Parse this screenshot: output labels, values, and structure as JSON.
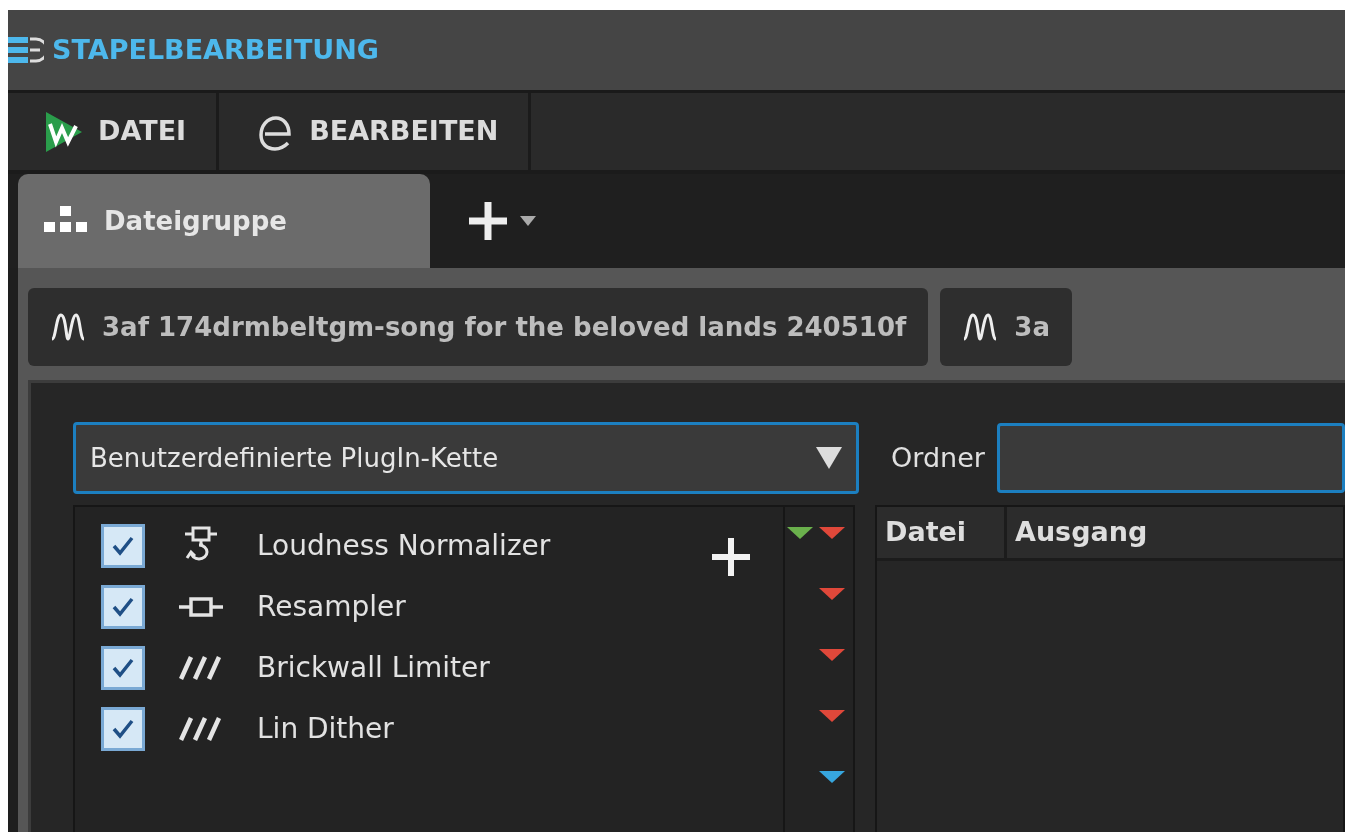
{
  "window": {
    "title": "STAPELBEARBEITUNG"
  },
  "menu": [
    {
      "label": "DATEI",
      "kind": "logo"
    },
    {
      "label": "BEARBEITEN",
      "kind": "script-e"
    }
  ],
  "tabs": [
    {
      "label": "Dateigruppe",
      "selected": true
    }
  ],
  "file_tabs": [
    {
      "label": "3af 174drmbeltgm-song for the beloved lands 240510f"
    },
    {
      "label": "3a"
    }
  ],
  "chain_select": {
    "value": "Benutzerdefinierte PlugIn-Kette"
  },
  "folder": {
    "label": "Ordner"
  },
  "plugins": [
    {
      "name": "Loudness Normalizer",
      "kind": "loop",
      "checked": true,
      "markers": [
        {
          "color": "#6ab04c"
        },
        {
          "color": "#e0483a"
        }
      ]
    },
    {
      "name": "Resampler",
      "kind": "box",
      "checked": true,
      "markers": [
        {
          "color": "#e0483a"
        }
      ]
    },
    {
      "name": "Brickwall Limiter",
      "kind": "slashes",
      "checked": true,
      "markers": [
        {
          "color": "#e0483a"
        }
      ]
    },
    {
      "name": "Lin Dither",
      "kind": "slashes",
      "checked": true,
      "markers": [
        {
          "color": "#e0483a"
        }
      ]
    }
  ],
  "end_marker": {
    "color": "#37a6de"
  },
  "table": {
    "columns": [
      "Datei",
      "Ausgang"
    ]
  }
}
